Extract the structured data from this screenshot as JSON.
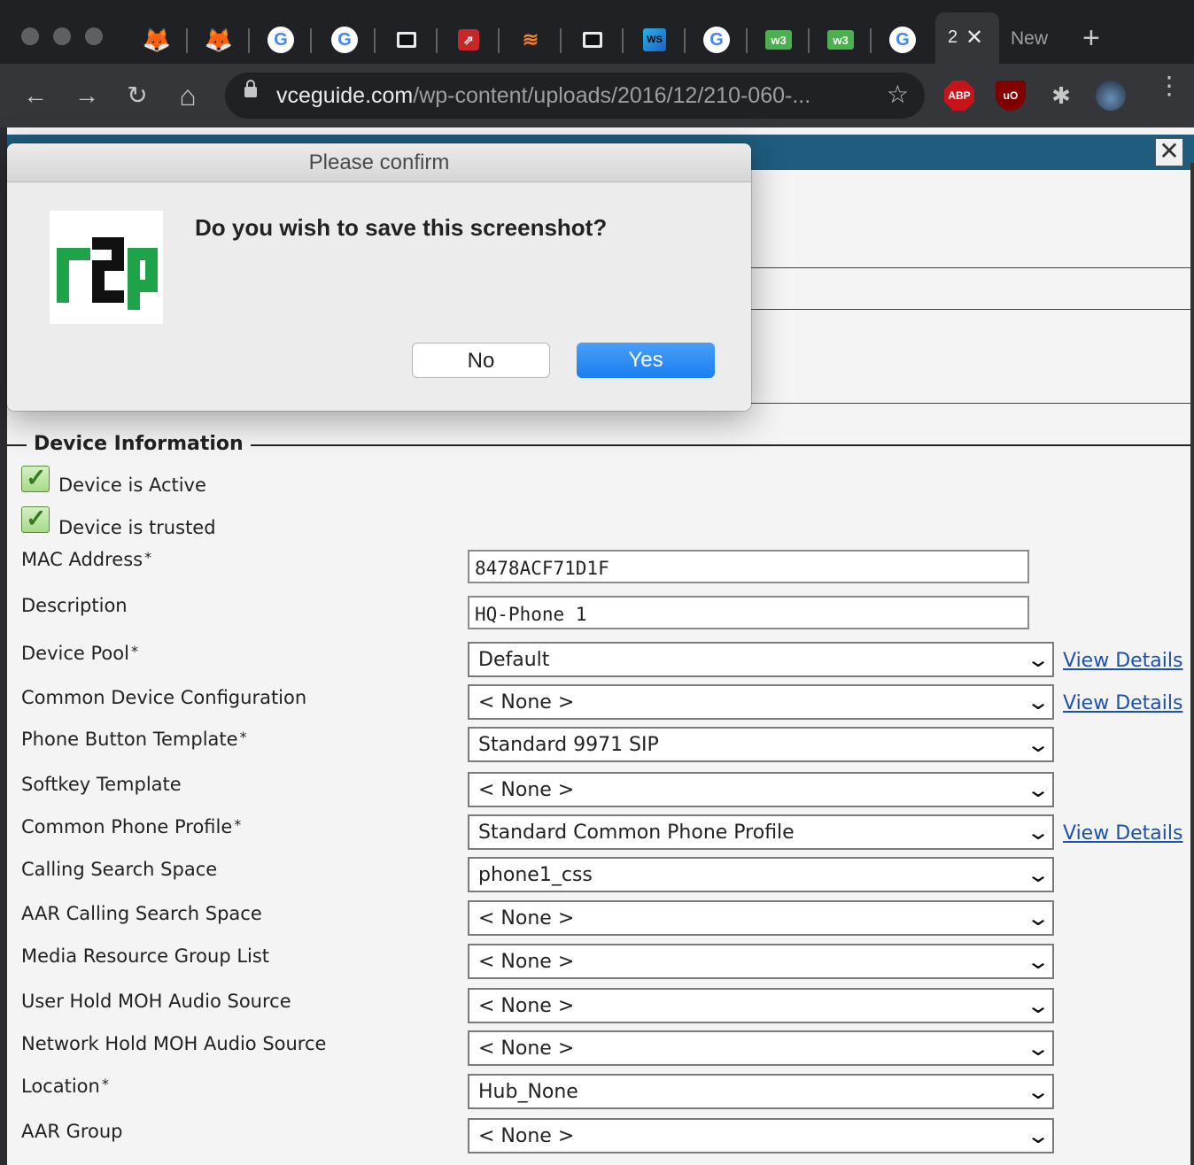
{
  "browser": {
    "tabs": [
      {
        "icon": "gitlab-icon",
        "glyph": "🦊"
      },
      {
        "icon": "gitlab-icon",
        "glyph": "🦊"
      },
      {
        "icon": "google-icon",
        "glyph": "G"
      },
      {
        "icon": "google-icon",
        "glyph": "G"
      },
      {
        "icon": "book-icon",
        "glyph": ""
      },
      {
        "icon": "red-app-icon",
        "glyph": "⇗"
      },
      {
        "icon": "stackoverflow-icon",
        "glyph": "≋"
      },
      {
        "icon": "book-icon",
        "glyph": ""
      },
      {
        "icon": "webstorm-icon",
        "glyph": "WS"
      },
      {
        "icon": "google-icon",
        "glyph": "G"
      },
      {
        "icon": "w3schools-icon",
        "glyph": "w3"
      },
      {
        "icon": "w3schools-icon",
        "glyph": "w3"
      },
      {
        "icon": "google-icon",
        "glyph": "G"
      }
    ],
    "active_tab_title": "2",
    "active_tab_close": "✕",
    "new_tab_label": "New",
    "new_tab_plus": "+",
    "nav": {
      "back": "←",
      "forward": "→",
      "reload": "↻",
      "home": "⌂"
    },
    "url_host": "vceguide.com",
    "url_path": "/wp-content/uploads/2016/12/210-060-...",
    "star": "☆",
    "extensions": {
      "abp": "ABP",
      "ublock": "uO",
      "puzzle": "✱"
    },
    "menu": "⋮",
    "colors": {
      "chrome_dark": "#202124",
      "chrome_toolbar": "#35363a"
    }
  },
  "popup": {
    "close": "✕"
  },
  "dialog": {
    "title": "Please confirm",
    "message": "Do you wish to save this screenshot?",
    "logo_text": "r2p",
    "no_label": "No",
    "yes_label": "Yes",
    "colors": {
      "yes_button": "#1a7ff0",
      "logo_green": "#1fa348"
    }
  },
  "form": {
    "legend": "Device Information",
    "checkboxes": [
      {
        "label": "Device is Active",
        "checked": true
      },
      {
        "label": "Device is trusted",
        "checked": true
      }
    ],
    "fields": {
      "mac": {
        "label": "MAC Address",
        "required": "*",
        "value": "8478ACF71D1F"
      },
      "description": {
        "label": "Description",
        "value": "HQ-Phone 1"
      },
      "device_pool": {
        "label": "Device Pool",
        "required": "*",
        "value": "Default",
        "link": "View Details"
      },
      "common_device_config": {
        "label": "Common Device Configuration",
        "value": "< None >",
        "link": "View Details"
      },
      "phone_button_template": {
        "label": "Phone Button Template",
        "required": "*",
        "value": "Standard 9971 SIP"
      },
      "softkey_template": {
        "label": "Softkey Template",
        "value": "< None >"
      },
      "common_phone_profile": {
        "label": "Common Phone Profile",
        "required": "*",
        "value": "Standard Common Phone Profile",
        "link": "View Details"
      },
      "css": {
        "label": "Calling Search Space",
        "value": "phone1_css"
      },
      "aar_css": {
        "label": "AAR Calling Search Space",
        "value": "< None >"
      },
      "mrgl": {
        "label": "Media Resource Group List",
        "value": "< None >"
      },
      "user_hold_moh": {
        "label": "User Hold MOH Audio Source",
        "value": "< None >"
      },
      "network_hold_moh": {
        "label": "Network Hold MOH Audio Source",
        "value": "< None >"
      },
      "location": {
        "label": "Location",
        "required": "*",
        "value": "Hub_None"
      },
      "aar_group": {
        "label": "AAR Group",
        "value": "< None >"
      }
    },
    "select_chevron": "⌄",
    "colors": {
      "link": "#1d50a8",
      "header_bar": "#1f5c7e"
    }
  }
}
